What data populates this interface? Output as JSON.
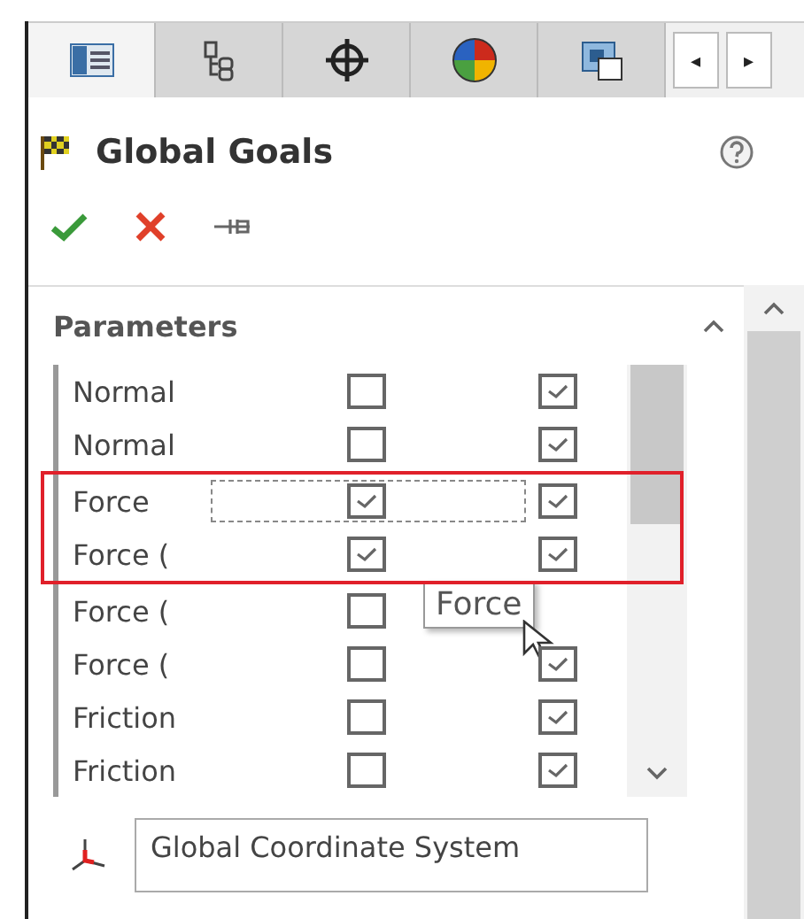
{
  "tabs": [
    {
      "selected": true
    },
    {
      "selected": false
    },
    {
      "selected": false
    },
    {
      "selected": false
    },
    {
      "selected": false
    }
  ],
  "tab_scroll": [
    "◂",
    "▸"
  ],
  "title": "Global Goals",
  "section": {
    "title": "Parameters",
    "expanded": true
  },
  "rows": [
    {
      "label": "Normal",
      "col_1": false,
      "col_2": true,
      "selected": false,
      "highlighted": false
    },
    {
      "label": "Normal",
      "col_1": false,
      "col_2": true,
      "selected": false,
      "highlighted": false
    },
    {
      "label": "Force",
      "col_1": true,
      "col_2": true,
      "selected": true,
      "highlighted": true
    },
    {
      "label": "Force (",
      "col_1": true,
      "col_2": true,
      "selected": false,
      "highlighted": true
    },
    {
      "label": "Force (",
      "col_1": false,
      "selected": false,
      "highlighted": false
    },
    {
      "label": "Force (",
      "col_1": false,
      "col_2": true,
      "selected": false,
      "highlighted": false
    },
    {
      "label": "Friction",
      "col_1": false,
      "col_2": true,
      "selected": false,
      "highlighted": false
    },
    {
      "label": "Friction",
      "col_1": false,
      "col_2": true,
      "selected": false,
      "highlighted": false
    }
  ],
  "tooltip": "Force",
  "coordinate_system": {
    "value": "Global Coordinate System"
  }
}
